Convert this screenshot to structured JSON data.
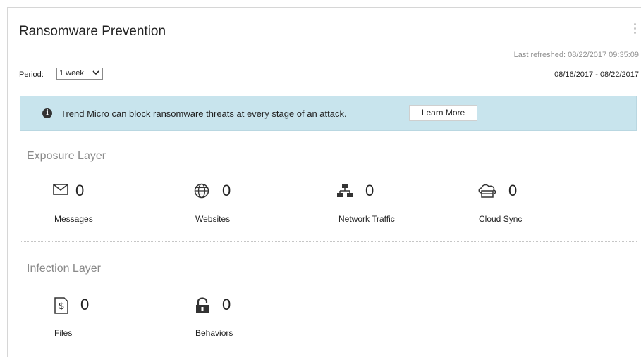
{
  "widget": {
    "title": "Ransomware Prevention",
    "last_refreshed": "Last refreshed: 08/22/2017 09:35:09",
    "period_label": "Period:",
    "period_value": "1 week",
    "date_range": "08/16/2017  -  08/22/2017",
    "menu_icon": "kebab-menu-icon"
  },
  "banner": {
    "message": "Trend Micro can block ransomware threats at every stage of an attack.",
    "button_label": "Learn More",
    "icon": "info-icon",
    "background": "#c8e4ed"
  },
  "exposure": {
    "title": "Exposure Layer",
    "items": [
      {
        "icon": "envelope-icon",
        "value": "0",
        "label": "Messages"
      },
      {
        "icon": "globe-icon",
        "value": "0",
        "label": "Websites"
      },
      {
        "icon": "network-icon",
        "value": "0",
        "label": "Network Traffic"
      },
      {
        "icon": "cloud-sync-icon",
        "value": "0",
        "label": "Cloud Sync"
      }
    ]
  },
  "infection": {
    "title": "Infection Layer",
    "items": [
      {
        "icon": "file-dollar-icon",
        "value": "0",
        "label": "Files"
      },
      {
        "icon": "lock-icon",
        "value": "0",
        "label": "Behaviors"
      }
    ]
  }
}
